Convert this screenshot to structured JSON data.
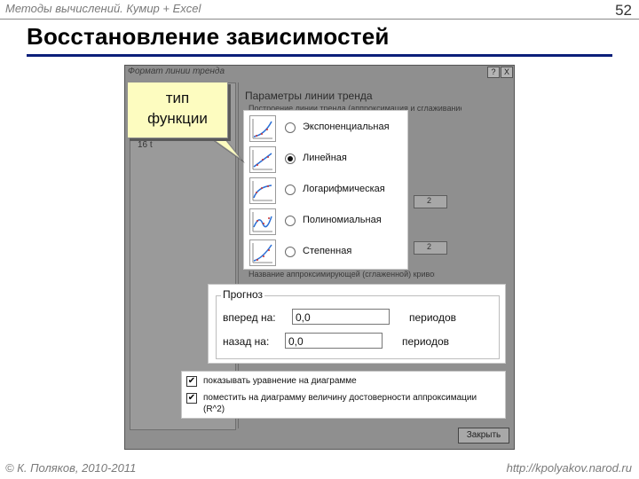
{
  "slide": {
    "header_left": "Методы вычислений. Кумир + Excel",
    "page_number": "52",
    "title": "Восстановление зависимостей",
    "footer_left": "© К. Поляков, 2010-2011",
    "footer_right": "http://kpolyakov.narod.ru"
  },
  "dialog": {
    "title": "Формат линии тренда",
    "help_button": "?",
    "close_x": "X",
    "section_title": "Параметры линии тренда",
    "subsection_title": "Построение линии тренда (аппроксимация и сглаживание)",
    "left_value": "16 t",
    "spin1": "2",
    "spin2": "2",
    "name_section": "Название аппроксимирующей (сглаженной) кривой",
    "close_button": "Закрыть",
    "callout": [
      "тип",
      "функции"
    ],
    "trend_types": [
      {
        "label": "Экспоненциальная",
        "selected": false
      },
      {
        "label": "Линейная",
        "selected": true
      },
      {
        "label": "Логарифмическая",
        "selected": false
      },
      {
        "label": "Полиномиальная",
        "selected": false
      },
      {
        "label": "Степенная",
        "selected": false
      }
    ],
    "forecast": {
      "title": "Прогноз",
      "forward_label": "вперед на:",
      "forward_value": "0,0",
      "forward_unit": "периодов",
      "backward_label": "назад на:",
      "backward_value": "0,0",
      "backward_unit": "периодов"
    },
    "options": {
      "show_equation": "показывать уравнение на диаграмме",
      "show_r2_line1": "поместить на диаграмму величину достоверности аппроксимации",
      "show_r2_line2": "(R^2)",
      "check_mark": "✔"
    }
  }
}
